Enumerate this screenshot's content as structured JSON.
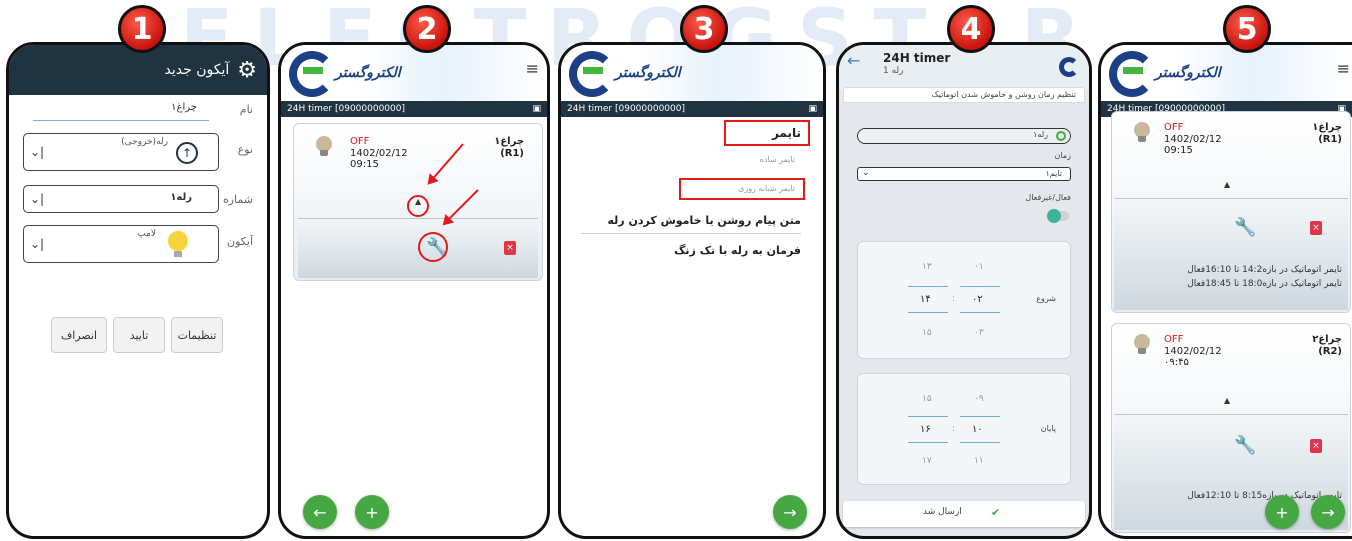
{
  "watermark": "ELECTROGSTAR",
  "badges": [
    "1",
    "2",
    "3",
    "4",
    "5"
  ],
  "phone1": {
    "title": "آیکون جدید",
    "name_label": "نام",
    "name_value": "چراغ۱",
    "type_label": "نوع",
    "type_value": "رله(خروجی)",
    "number_label": "شماره",
    "number_value": "رله۱",
    "icon_label": "آیکون",
    "icon_value": "لامپ",
    "btn_settings": "تنظیمات",
    "btn_confirm": "تایید",
    "btn_cancel": "انصراف"
  },
  "header": {
    "brand": "الکتروگستر",
    "info_left": "24H timer  [09000000000]"
  },
  "phone2": {
    "status": "OFF",
    "date": "1402/02/12",
    "time": "09:15",
    "name": "چراغ۱",
    "id": "(R1)"
  },
  "phone3": {
    "timer": "تایمر",
    "simple_timer": "تایمر ساده",
    "daily_timer": "تایمر شبانه روزی",
    "msg_text": "متن پیام روشن یا خاموش کردن رله",
    "ring_cmd": "فرمان به رله با تک زنگ"
  },
  "phone4": {
    "title": "24H timer",
    "subtitle": "رله 1",
    "instruction": "تنظیم زمان روشن و خاموش شدن اتوماتیک",
    "relay": "رله۱",
    "time_label": "زمان",
    "timer_select": "تایم۱",
    "active_label": "فعال/غیرفعال",
    "start_label": "شروع",
    "end_label": "پایان",
    "start_h": [
      "۱۳",
      "۱۴",
      "۱۵"
    ],
    "start_m": [
      "۰۱",
      "۰۲",
      "۰۳"
    ],
    "end_h": [
      "۱۵",
      "۱۶",
      "۱۷"
    ],
    "end_m": [
      "۰۹",
      "۱۰",
      "۱۱"
    ],
    "colon": ":",
    "sent": "ارسال شد"
  },
  "phone5": {
    "card1": {
      "status": "OFF",
      "date": "1402/02/12",
      "time": "09:15",
      "name": "چراغ۱",
      "id": "(R1)",
      "line1": "تایمر اتوماتیک در بازه14:2 تا 16:10فعال",
      "line2": "تایمر اتوماتیک در بازه18:0 تا 18:45فعال"
    },
    "card2": {
      "status": "OFF",
      "date": "1402/02/12",
      "time": "۰۹:۴۵",
      "name": "چراغ۲",
      "id": "(R2)",
      "line1": "تایمر اتوماتیک در بازه8:15 تا 12:10فعال"
    }
  }
}
